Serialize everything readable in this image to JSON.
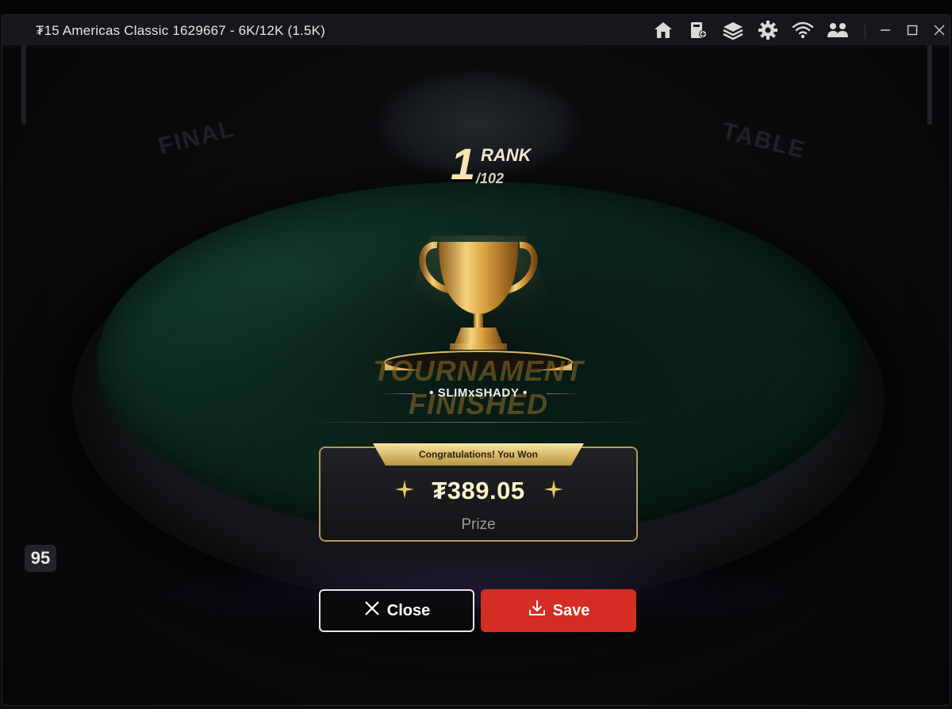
{
  "window": {
    "title": "₮15 Americas Classic 1629667 - 6K/12K (1.5K)",
    "toolbar_icons": [
      "home-icon",
      "cashier-icon",
      "layers-icon",
      "gear-icon",
      "wifi-icon",
      "players-icon"
    ],
    "controls": [
      "minimize-icon",
      "maximize-icon",
      "close-icon"
    ]
  },
  "scene": {
    "signs": [
      "FINAL",
      "TABLE"
    ],
    "banner": "TOURNAMENT FINISHED",
    "seat_badge": "95"
  },
  "result": {
    "rank": "1",
    "rank_label": "RANK",
    "rank_total": "/102",
    "player_name": "• SLIMxSHADY •",
    "ribbon": "Congratulations! You Won",
    "prize_amount": "₮389.05",
    "prize_label": "Prize"
  },
  "actions": {
    "close_label": "Close",
    "save_label": "Save"
  },
  "colors": {
    "accent_gold": "#d7b866",
    "save_red": "#d52d24",
    "felt_green": "#123d2f"
  }
}
